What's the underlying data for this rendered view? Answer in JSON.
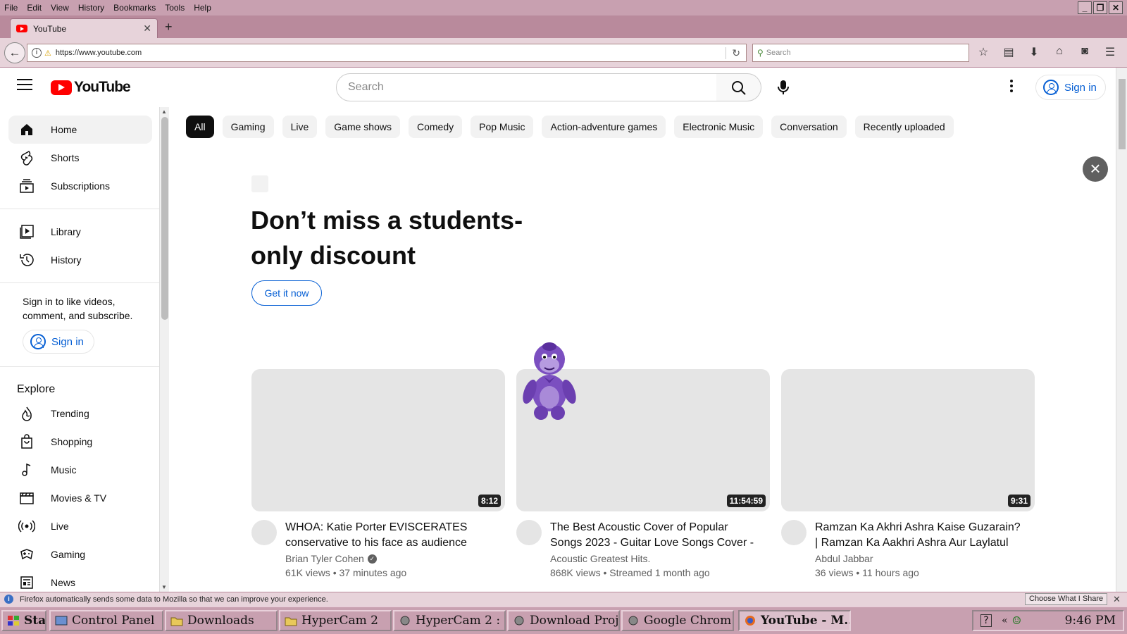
{
  "browser": {
    "menu": [
      "File",
      "Edit",
      "View",
      "History",
      "Bookmarks",
      "Tools",
      "Help"
    ],
    "tab_title": "YouTube",
    "url": "https://www.youtube.com",
    "search_placeholder": "Search"
  },
  "yt": {
    "logo_text": "YouTube",
    "search_placeholder": "Search",
    "sign_in": "Sign in"
  },
  "sidebar": {
    "items": [
      {
        "label": "Home",
        "icon": "home-icon"
      },
      {
        "label": "Shorts",
        "icon": "shorts-icon"
      },
      {
        "label": "Subscriptions",
        "icon": "subscriptions-icon"
      },
      {
        "label": "Library",
        "icon": "library-icon"
      },
      {
        "label": "History",
        "icon": "history-icon"
      }
    ],
    "signin_prompt": "Sign in to like videos, comment, and subscribe.",
    "signin_button": "Sign in",
    "explore_heading": "Explore",
    "explore": [
      {
        "label": "Trending",
        "icon": "trending-icon"
      },
      {
        "label": "Shopping",
        "icon": "shopping-icon"
      },
      {
        "label": "Music",
        "icon": "music-icon"
      },
      {
        "label": "Movies & TV",
        "icon": "movies-icon"
      },
      {
        "label": "Live",
        "icon": "live-icon"
      },
      {
        "label": "Gaming",
        "icon": "gaming-icon"
      },
      {
        "label": "News",
        "icon": "news-icon"
      }
    ]
  },
  "chips": [
    "All",
    "Gaming",
    "Live",
    "Game shows",
    "Comedy",
    "Pop Music",
    "Action-adventure games",
    "Electronic Music",
    "Conversation",
    "Recently uploaded"
  ],
  "promo": {
    "title": "Don’t miss a students-only discount",
    "button": "Get it now"
  },
  "videos": [
    {
      "title": "WHOA: Katie Porter EVISCERATES conservative to his face as audience",
      "channel": "Brian Tyler Cohen",
      "verified": true,
      "stats": "61K views • 37 minutes ago",
      "duration": "8:12"
    },
    {
      "title": "The Best Acoustic Cover of Popular Songs 2023 - Guitar Love Songs Cover -",
      "channel": "Acoustic Greatest Hits.",
      "verified": false,
      "stats": "868K views • Streamed 1 month ago",
      "duration": "11:54:59"
    },
    {
      "title": "Ramzan Ka Akhri Ashra Kaise Guzarain? | Ramzan Ka Aakhri Ashra Aur Laylatul",
      "channel": "Abdul Jabbar",
      "verified": false,
      "stats": "36 views • 11 hours ago",
      "duration": "9:31"
    }
  ],
  "notification": {
    "text": "Firefox automatically sends some data to Mozilla so that we can improve your experience.",
    "button": "Choose What I Share"
  },
  "taskbar": {
    "start": "Start",
    "buttons": [
      "Control Panel",
      "Downloads",
      "HyperCam 2",
      "HyperCam 2 : ...",
      "Download Proj...",
      "Google Chrom...",
      "YouTube - M..."
    ],
    "clock": "9:46 PM"
  },
  "colors": {
    "accent": "#065fd4",
    "brand": "#ff0000",
    "chrome": "#c8a0b0"
  }
}
